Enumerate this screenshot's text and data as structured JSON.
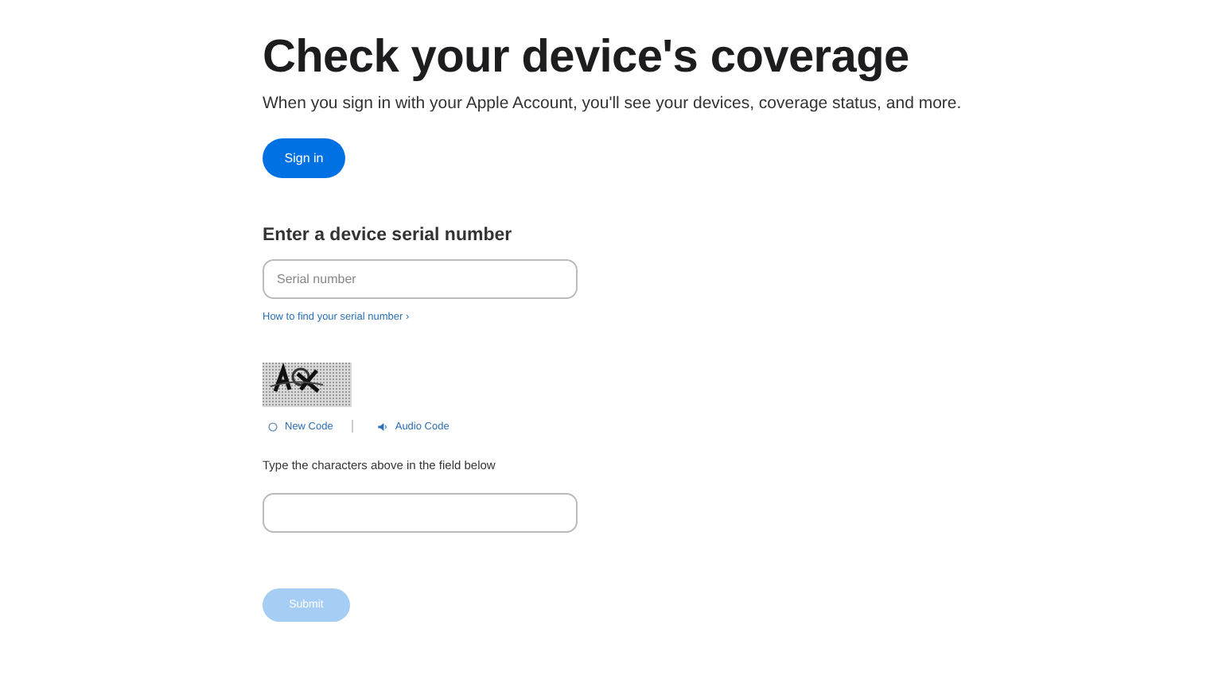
{
  "title": "Check your device's coverage",
  "subtitle": "When you sign in with your Apple Account, you'll see your devices, coverage status, and more.",
  "sign_in_button": "Sign in",
  "serial_section": {
    "heading": "Enter a device serial number",
    "placeholder": "Serial number",
    "help_link": "How to find your serial number ›"
  },
  "captcha": {
    "kind": "picture",
    "new_code": "New Code",
    "audio_code": "Audio Code",
    "instruction": "Type the characters above in the field below"
  },
  "submit_button": {
    "label": "Submit",
    "disabled": true
  }
}
